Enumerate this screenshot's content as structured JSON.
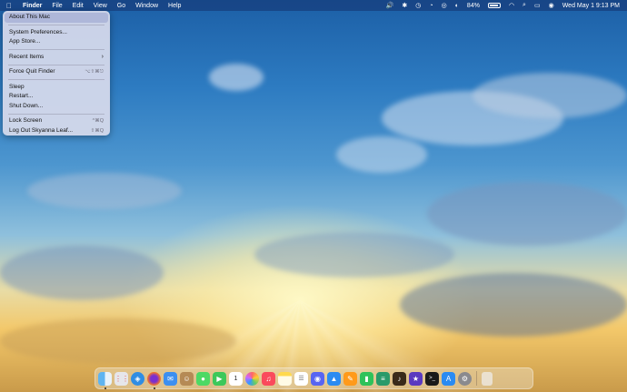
{
  "menubar": {
    "app_name": "Finder",
    "items": [
      "File",
      "Edit",
      "View",
      "Go",
      "Window",
      "Help"
    ],
    "battery_percent": "84%",
    "clock": "Wed May 1  9:13 PM"
  },
  "apple_menu": {
    "about": "About This Mac",
    "system_prefs": "System Preferences...",
    "app_store": "App Store...",
    "recent_items": "Recent Items",
    "force_quit": "Force Quit Finder",
    "force_quit_shortcut": "⌥⇧⌘⎋",
    "sleep": "Sleep",
    "restart": "Restart...",
    "shut_down": "Shut Down...",
    "lock_screen": "Lock Screen",
    "lock_shortcut": "^⌘Q",
    "log_out": "Log Out Skyanna Leaf...",
    "log_out_shortcut": "⇧⌘Q"
  },
  "dock": {
    "icons": [
      "finder",
      "launchpad",
      "safari",
      "firefox",
      "mail",
      "contacts",
      "messages",
      "facetime",
      "calendar",
      "photos",
      "music",
      "notes",
      "reminders",
      "discord",
      "keynote",
      "pages",
      "numbers",
      "layers",
      "garageband",
      "imovie",
      "terminal",
      "app-store",
      "system-preferences",
      "trash"
    ],
    "calendar_date": "1"
  },
  "colors": {
    "menubar": "#1e3c78",
    "menu_bg": "#d7daec",
    "sky_top": "#1c5fa6",
    "horizon": "#f3c86a"
  }
}
